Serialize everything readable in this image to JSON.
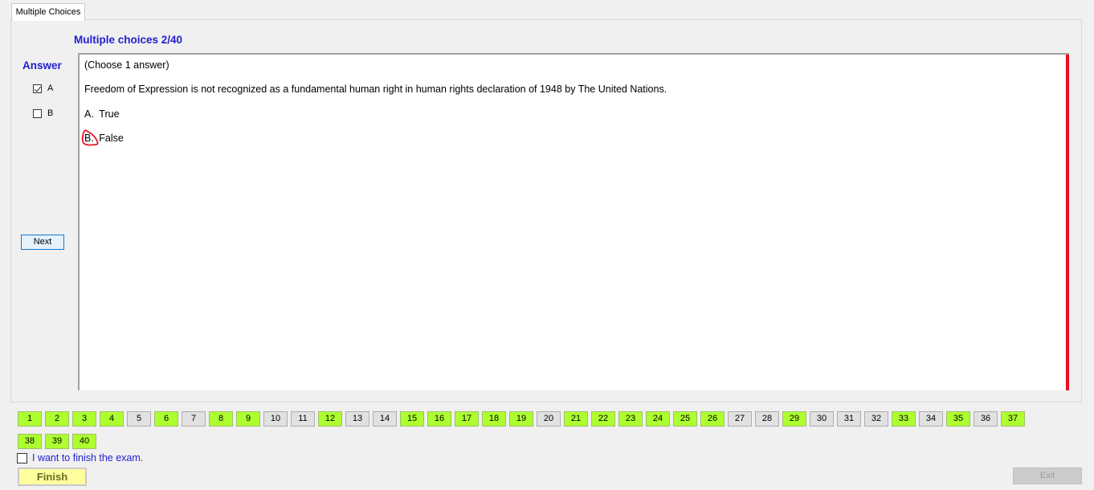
{
  "tab": {
    "label": "Multiple Choices"
  },
  "header": {
    "title": "Multiple choices 2/40"
  },
  "answer": {
    "label": "Answer",
    "options": [
      {
        "letter": "A",
        "checked": true
      },
      {
        "letter": "B",
        "checked": false
      }
    ],
    "next_label": "Next"
  },
  "question": {
    "instruction": "(Choose 1 answer)",
    "text": "Freedom of Expression is not recognized as a fundamental human right in human rights declaration of 1948 by The United Nations.",
    "choices": [
      {
        "letter": "A.",
        "text": "True"
      },
      {
        "letter": "B.",
        "text": "False"
      }
    ]
  },
  "navigator": {
    "numbers": [
      "1",
      "2",
      "3",
      "4",
      "5",
      "6",
      "7",
      "8",
      "9",
      "10",
      "11",
      "12",
      "13",
      "14",
      "15",
      "16",
      "17",
      "18",
      "19",
      "20",
      "21",
      "22",
      "23",
      "24",
      "25",
      "26",
      "27",
      "28",
      "29",
      "30",
      "31",
      "32",
      "33",
      "34",
      "35",
      "36",
      "37",
      "38",
      "39",
      "40"
    ],
    "answered": [
      1,
      2,
      3,
      4,
      6,
      8,
      9,
      12,
      15,
      16,
      17,
      18,
      19,
      21,
      22,
      23,
      24,
      25,
      26,
      29,
      33,
      35,
      37,
      38,
      39,
      40
    ]
  },
  "footer": {
    "finish_check_label": "I want to finish the exam.",
    "finish_checked": false,
    "finish_label": "Finish",
    "exit_label": "Exit"
  },
  "colors": {
    "answered": "#adff2f",
    "title": "#1f1fd0",
    "scrollbar": "#e81123",
    "annotation": "#e81123"
  }
}
